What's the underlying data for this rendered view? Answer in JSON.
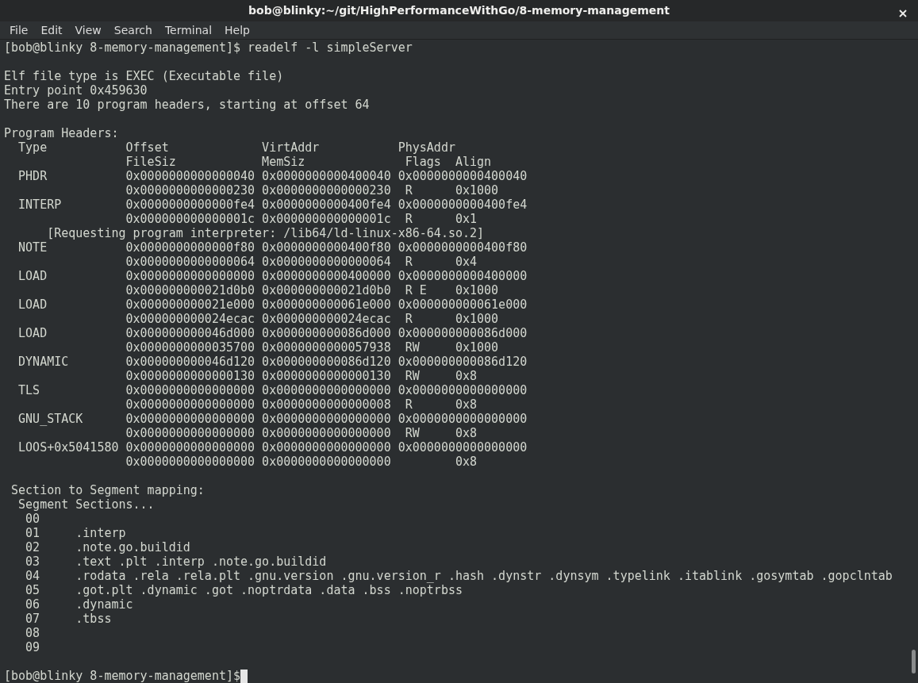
{
  "window": {
    "title": "bob@blinky:~/git/HighPerformanceWithGo/8-memory-management"
  },
  "menu": [
    "File",
    "Edit",
    "View",
    "Search",
    "Terminal",
    "Help"
  ],
  "terminal": {
    "blocks": [
      [
        "[bob@blinky 8-memory-management]$ readelf -l simpleServer"
      ],
      [
        "Elf file type is EXEC (Executable file)",
        "Entry point 0x459630",
        "There are 10 program headers, starting at offset 64"
      ],
      [
        "Program Headers:",
        "  Type           Offset             VirtAddr           PhysAddr",
        "                 FileSiz            MemSiz              Flags  Align",
        "  PHDR           0x0000000000000040 0x0000000000400040 0x0000000000400040",
        "                 0x0000000000000230 0x0000000000000230  R      0x1000",
        "  INTERP         0x0000000000000fe4 0x0000000000400fe4 0x0000000000400fe4",
        "                 0x000000000000001c 0x000000000000001c  R      0x1",
        "      [Requesting program interpreter: /lib64/ld-linux-x86-64.so.2]",
        "  NOTE           0x0000000000000f80 0x0000000000400f80 0x0000000000400f80",
        "                 0x0000000000000064 0x0000000000000064  R      0x4",
        "  LOAD           0x0000000000000000 0x0000000000400000 0x0000000000400000",
        "                 0x000000000021d0b0 0x000000000021d0b0  R E    0x1000",
        "  LOAD           0x000000000021e000 0x000000000061e000 0x000000000061e000",
        "                 0x000000000024ecac 0x000000000024ecac  R      0x1000",
        "  LOAD           0x000000000046d000 0x000000000086d000 0x000000000086d000",
        "                 0x0000000000035700 0x0000000000057938  RW     0x1000",
        "  DYNAMIC        0x000000000046d120 0x000000000086d120 0x000000000086d120",
        "                 0x0000000000000130 0x0000000000000130  RW     0x8",
        "  TLS            0x0000000000000000 0x0000000000000000 0x0000000000000000",
        "                 0x0000000000000000 0x0000000000000008  R      0x8",
        "  GNU_STACK      0x0000000000000000 0x0000000000000000 0x0000000000000000",
        "                 0x0000000000000000 0x0000000000000000  RW     0x8",
        "  LOOS+0x5041580 0x0000000000000000 0x0000000000000000 0x0000000000000000",
        "                 0x0000000000000000 0x0000000000000000         0x8"
      ],
      [
        " Section to Segment mapping:",
        "  Segment Sections...",
        "   00",
        "   01     .interp",
        "   02     .note.go.buildid",
        "   03     .text .plt .interp .note.go.buildid",
        "   04     .rodata .rela .rela.plt .gnu.version .gnu.version_r .hash .dynstr .dynsym .typelink .itablink .gosymtab .gopclntab",
        "   05     .got.plt .dynamic .got .noptrdata .data .bss .noptrbss",
        "   06     .dynamic",
        "   07     .tbss",
        "   08",
        "   09"
      ]
    ],
    "prompt": "[bob@blinky 8-memory-management]$"
  }
}
